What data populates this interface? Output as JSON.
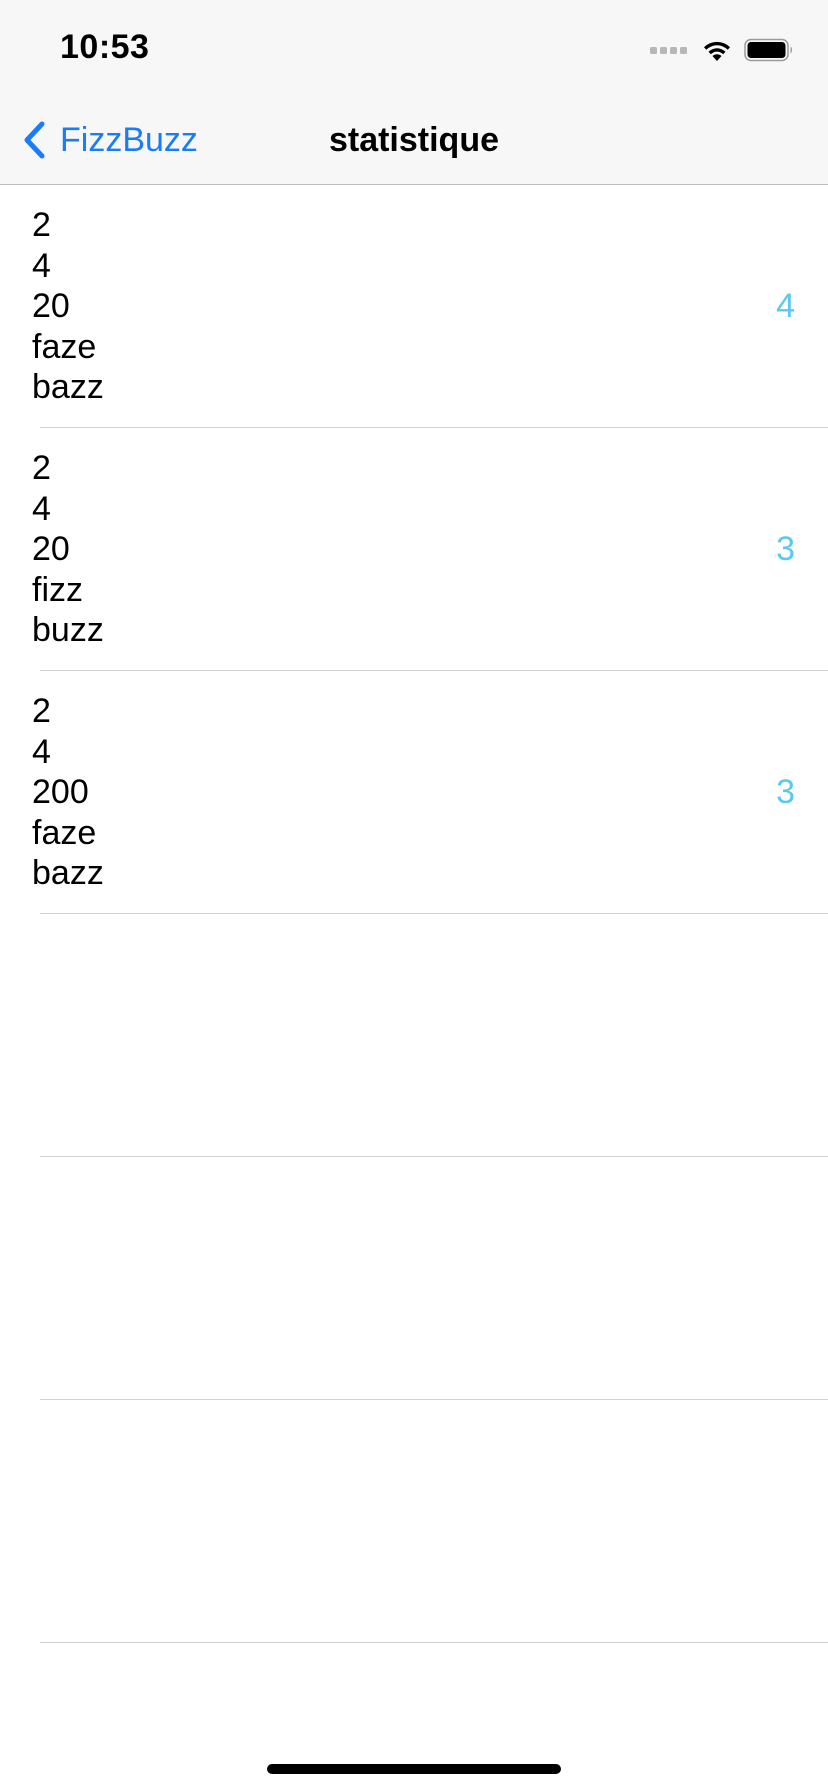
{
  "status_bar": {
    "time": "10:53",
    "icons": [
      "cellular-signal-icon",
      "wifi-icon",
      "battery-icon"
    ]
  },
  "nav_bar": {
    "back_label": "FizzBuzz",
    "title": "statistique"
  },
  "colors": {
    "tint": "#1a7cf6",
    "count": "#5bc8f2",
    "separator": "#d2d2d6",
    "bar_background": "#f7f7f7"
  },
  "rows": [
    {
      "lines": [
        "2",
        "4",
        "20",
        "faze",
        "bazz"
      ],
      "count": "4"
    },
    {
      "lines": [
        "2",
        "4",
        "20",
        "fizz",
        "buzz"
      ],
      "count": "3"
    },
    {
      "lines": [
        "2",
        "4",
        "200",
        "faze",
        "bazz"
      ],
      "count": "3"
    },
    {
      "lines": [],
      "count": ""
    },
    {
      "lines": [],
      "count": ""
    },
    {
      "lines": [],
      "count": ""
    }
  ]
}
